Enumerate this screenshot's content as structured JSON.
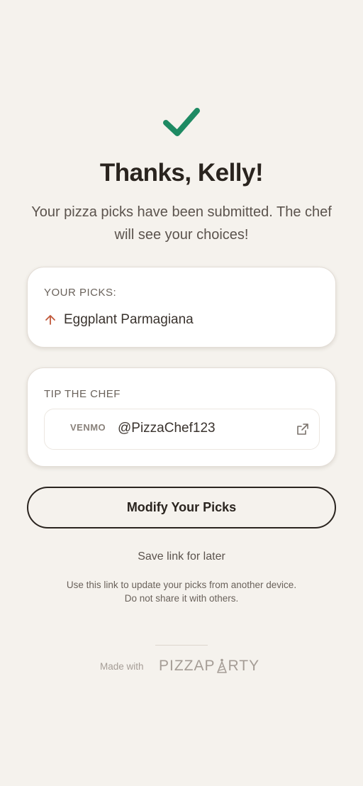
{
  "header": {
    "check_icon": "check-icon",
    "check_color": "#1e8a63",
    "title": "Thanks, Kelly!",
    "subtitle": "Your pizza picks have been submitted. The chef will see your choices!"
  },
  "picks": {
    "label": "YOUR PICKS:",
    "items": [
      {
        "icon": "arrow-up-icon",
        "name": "Eggplant Parmagiana"
      }
    ],
    "accent_color": "#c0583a"
  },
  "tip": {
    "label": "TIP THE CHEF",
    "method": "VENMO",
    "handle": "@PizzaChef123",
    "link_icon": "external-link-icon"
  },
  "actions": {
    "modify_label": "Modify Your Picks",
    "save_link_label": "Save link for later"
  },
  "notes": {
    "line1": "Use this link to update your picks from another device.",
    "line2": "Do not share it with others."
  },
  "footer": {
    "made_with": "Made with",
    "brand_part1": "PIZZAP",
    "brand_part2": "RTY",
    "brand_logo_text": "PIZZAPARTY"
  }
}
